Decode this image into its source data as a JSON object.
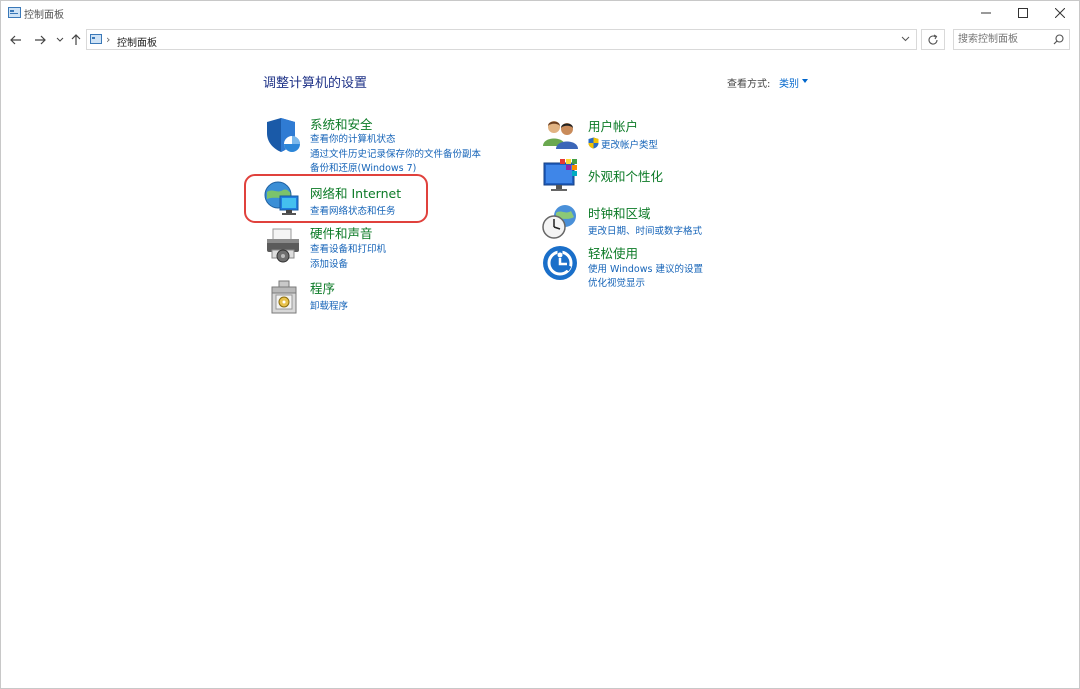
{
  "window": {
    "title": "控制面板"
  },
  "address": {
    "path": "控制面板"
  },
  "search": {
    "placeholder": "搜索控制面板"
  },
  "header": {
    "heading": "调整计算机的设置",
    "view_by_label": "查看方式:",
    "view_by_value": "类别"
  },
  "categories": [
    {
      "title": "系统和安全",
      "links": [
        "查看你的计算机状态",
        "通过文件历史记录保存你的文件备份副本",
        "备份和还原(Windows 7)"
      ],
      "icon": "shield-icon"
    },
    {
      "title": "网络和 Internet",
      "links": [
        "查看网络状态和任务"
      ],
      "icon": "network-globe-icon"
    },
    {
      "title": "硬件和声音",
      "links": [
        "查看设备和打印机",
        "添加设备"
      ],
      "icon": "printer-icon"
    },
    {
      "title": "程序",
      "links": [
        "卸载程序"
      ],
      "icon": "programs-box-icon"
    },
    {
      "title": "用户帐户",
      "links": [
        "更改帐户类型"
      ],
      "icon": "users-icon"
    },
    {
      "title": "外观和个性化",
      "links": [],
      "icon": "monitor-palette-icon"
    },
    {
      "title": "时钟和区域",
      "links": [
        "更改日期、时间或数字格式"
      ],
      "icon": "clock-globe-icon"
    },
    {
      "title": "轻松使用",
      "links": [
        "使用 Windows 建议的设置",
        "优化视觉显示"
      ],
      "icon": "ease-of-access-icon"
    }
  ],
  "colors": {
    "category_title": "#0b7a26",
    "link": "#1664b8",
    "heading": "#1e3287",
    "highlight": "#e0413c"
  }
}
